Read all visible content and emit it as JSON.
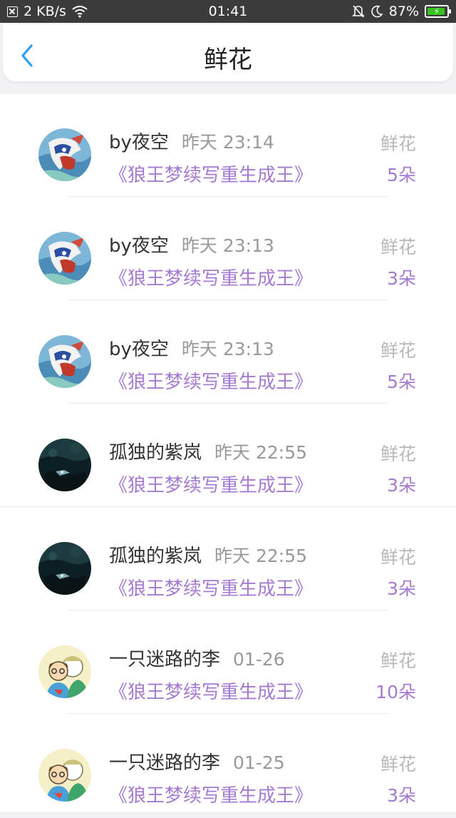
{
  "status_bar": {
    "net_speed": "2 KB/s",
    "time": "01:41",
    "battery": "87%",
    "battery_level": 0.87
  },
  "header": {
    "title": "鲜花"
  },
  "records": [
    {
      "user": "by夜空",
      "time": "昨天 23:14",
      "book": "《狼王梦续写重生成王》",
      "label": "鲜花",
      "count": "5朵",
      "avatar": "mask"
    },
    {
      "user": "by夜空",
      "time": "昨天 23:13",
      "book": "《狼王梦续写重生成王》",
      "label": "鲜花",
      "count": "3朵",
      "avatar": "mask"
    },
    {
      "user": "by夜空",
      "time": "昨天 23:13",
      "book": "《狼王梦续写重生成王》",
      "label": "鲜花",
      "count": "5朵",
      "avatar": "mask"
    },
    {
      "user": "孤独的紫岚",
      "time": "昨天 22:55",
      "book": "《狼王梦续写重生成王》",
      "label": "鲜花",
      "count": "3朵",
      "avatar": "night"
    },
    {
      "user": "孤独的紫岚",
      "time": "昨天 22:55",
      "book": "《狼王梦续写重生成王》",
      "label": "鲜花",
      "count": "3朵",
      "avatar": "night"
    },
    {
      "user": "一只迷路的李",
      "time": "01-26",
      "book": "《狼王梦续写重生成王》",
      "label": "鲜花",
      "count": "10朵",
      "avatar": "cartoon"
    },
    {
      "user": "一只迷路的李",
      "time": "01-25",
      "book": "《狼王梦续写重生成王》",
      "label": "鲜花",
      "count": "3朵",
      "avatar": "cartoon"
    }
  ],
  "colors": {
    "accent_purple": "#a57ad1",
    "back_arrow": "#2a9df4",
    "battery_green": "#35c21f"
  }
}
